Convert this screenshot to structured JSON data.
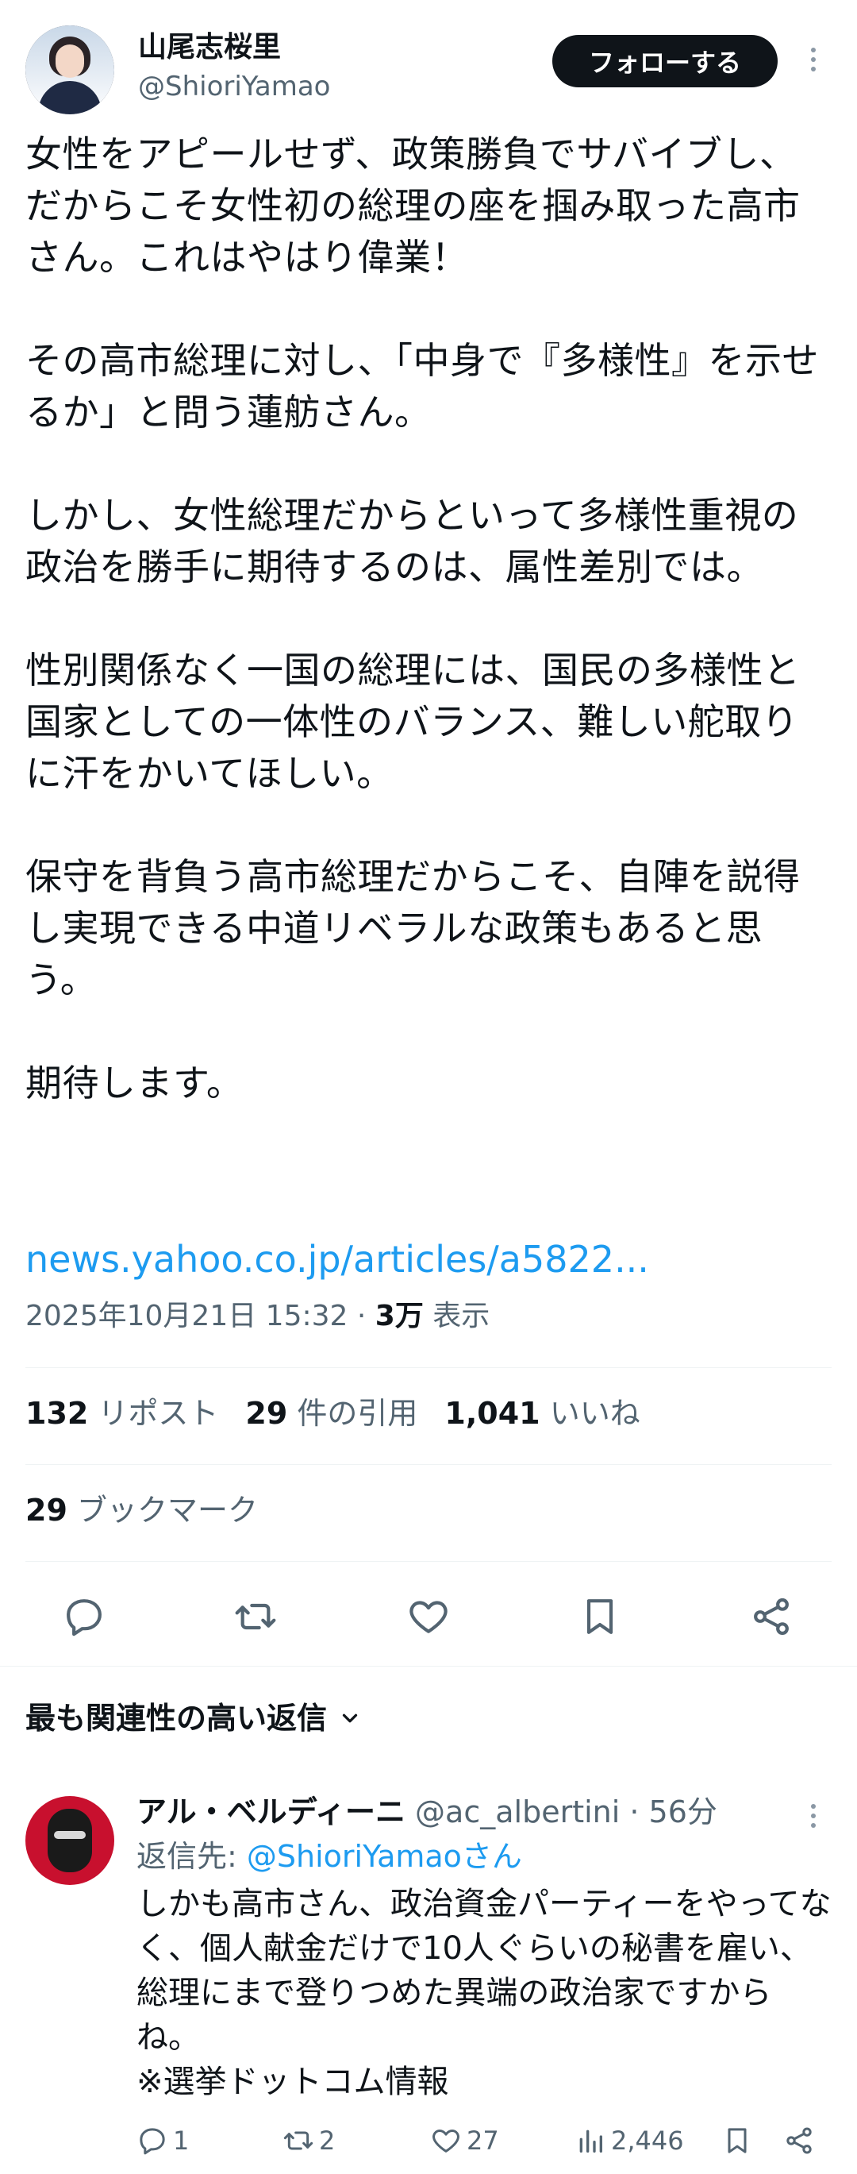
{
  "author": {
    "display_name": "山尾志桜里",
    "handle": "@ShioriYamao",
    "follow_label": "フォローする"
  },
  "tweet": {
    "text": "女性をアピールせず、政策勝負でサバイブし、だからこそ女性初の総理の座を掴み取った高市さん。これはやはり偉業！\n\nその高市総理に対し、「中身で『多様性』を示せるか」と問う蓮舫さん。\n\nしかし、女性総理だからといって多様性重視の政治を勝手に期待するのは、属性差別では。\n\n性別関係なく一国の総理には、国民の多様性と国家としての一体性のバランス、難しい舵取りに汗をかいてほしい。\n\n保守を背負う高市総理だからこそ、自陣を説得し実現できる中道リベラルな政策もあると思う。\n\n期待します。",
    "link": "news.yahoo.co.jp/articles/a5822...",
    "timestamp": "2025年10月21日 15:32 · ",
    "views_count": "3万",
    "views_label": " 表示"
  },
  "stats": {
    "reposts_count": "132",
    "reposts_label": " リポスト",
    "quotes_count": "29",
    "quotes_label": " 件の引用",
    "likes_count": "1,041",
    "likes_label": " いいね",
    "bookmarks_count": "29",
    "bookmarks_label": " ブックマーク"
  },
  "actions": {
    "icons": [
      "reply-icon",
      "repost-icon",
      "like-icon",
      "bookmark-icon",
      "share-icon"
    ]
  },
  "replies_section": {
    "sort_label": "最も関連性の高い返信"
  },
  "reply": {
    "display_name": "アル・ベルディーニ",
    "handle_meta": " @ac_albertini · 56分",
    "reply_to_prefix": "返信先: ",
    "reply_to_mention": "@ShioriYamaoさん",
    "text": "しかも高市さん、政治資金パーティーをやってなく、個人献金だけで10人ぐらいの秘書を雇い、総理にまで登りつめた異端の政治家ですからね。\n※選挙ドットコム情報",
    "reply_count": "1",
    "repost_count": "2",
    "like_count": "27",
    "view_count": "2,446"
  },
  "colors": {
    "text_primary": "#0f1419",
    "text_secondary": "#536471",
    "link_blue": "#1d9bf0",
    "divider": "#eff3f4",
    "button_dark": "#0f1419"
  }
}
